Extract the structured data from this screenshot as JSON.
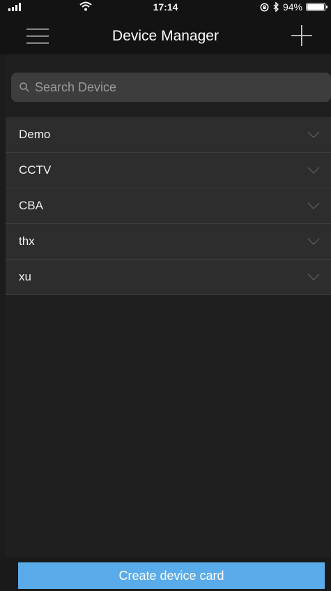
{
  "status_bar": {
    "time": "17:14",
    "battery_text": "94%",
    "battery_level": 0.94,
    "icons": [
      "signal-icon",
      "wifi-icon",
      "orientation-lock-icon",
      "bluetooth-icon",
      "battery-icon"
    ]
  },
  "header": {
    "title": "Device Manager",
    "menu_icon": "hamburger-menu-icon",
    "add_icon": "plus-icon"
  },
  "search": {
    "placeholder": "Search Device",
    "value": "",
    "icon": "search-icon"
  },
  "devices": [
    {
      "name": "Demo"
    },
    {
      "name": "CCTV"
    },
    {
      "name": "CBA"
    },
    {
      "name": "thx"
    },
    {
      "name": "xu"
    }
  ],
  "footer": {
    "create_label": "Create device card"
  },
  "colors": {
    "background": "#1c1c1c",
    "bar": "#131313",
    "row": "#2d2d2d",
    "search": "#3d3d3d",
    "accent": "#5aabe9"
  }
}
